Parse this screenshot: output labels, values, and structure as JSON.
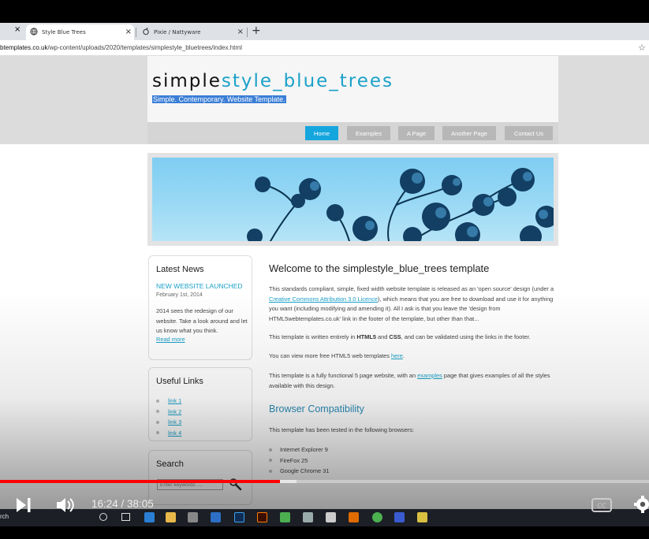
{
  "browser": {
    "tabs": [
      {
        "label": "Style Blue Trees",
        "active": true
      },
      {
        "label": "Pixie / Nattyware",
        "active": false
      }
    ],
    "new_tab_glyph": "+",
    "close_glyph": "×",
    "url_host": "btemplates.co.uk",
    "url_path": "/wp-content/uploads/2020/templates/simplestyle_bluetrees/index.html"
  },
  "site": {
    "logo_plain": "simple",
    "logo_accent": "style_blue_trees",
    "slogan": "Simple. Contemporary. Website Template.",
    "menu": [
      "Home",
      "Examples",
      "A Page",
      "Another Page",
      "Contact Us"
    ],
    "menu_selected": "Home",
    "accent_color": "#1ba1c9"
  },
  "sidebar": {
    "news": {
      "title": "Latest News",
      "item_title": "NEW WEBSITE LAUNCHED",
      "date": "February 1st, 2014",
      "body": "2014 sees the redesign of our website. Take a look around and let us know what you think.",
      "read_more": "Read more"
    },
    "links": {
      "title": "Useful Links",
      "items": [
        "link 1",
        "link 2",
        "link 3",
        "link 4"
      ]
    },
    "search": {
      "title": "Search",
      "placeholder": "Enter keywords ...."
    }
  },
  "content": {
    "welcome_heading": "Welcome to the simplestyle_blue_trees template",
    "p1_before": "This standards compliant, simple, fixed width website template is released as an 'open source' design (under a ",
    "p1_link": "Creative Commons Attribution 3.0 Licence",
    "p1_after": "), which means that you are free to download and use it for anything you want (including modifying and amending it). All I ask is that you leave the 'design from HTML5webtemplates.co.uk' link in the footer of the template, but other than that...",
    "p2_a": "This template is written entirely in ",
    "p2_b1": "HTML5",
    "p2_c": " and ",
    "p2_b2": "CSS",
    "p2_d": ", and can be validated using the links in the footer.",
    "p3_a": "You can view more free HTML5 web templates ",
    "p3_link": "here",
    "p3_b": ".",
    "p4_a": "This template is a fully functional 5 page website, with an ",
    "p4_link": "examples",
    "p4_b": " page that gives examples of all the styles available with this design.",
    "browser_heading": "Browser Compatibility",
    "p5": "This template has been tested in the following browsers:",
    "browsers": [
      "Internet Explorer 9",
      "FireFox 25",
      "Google Chrome 31"
    ]
  },
  "player": {
    "time_label": "16:24 / 38:05",
    "played_fraction": 0.431,
    "buffered_fraction": 0.457,
    "icons": [
      "next-icon",
      "volume-icon",
      "captions-icon",
      "settings-icon"
    ]
  },
  "taskbar": {
    "search_text": "rch"
  }
}
